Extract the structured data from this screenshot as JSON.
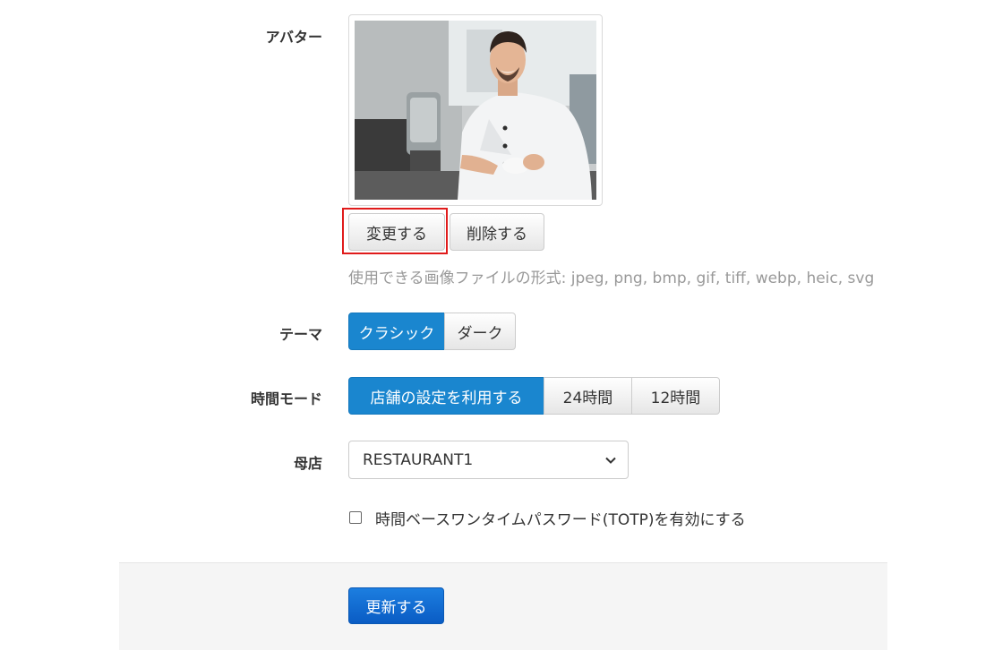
{
  "avatar": {
    "label": "アバター",
    "change_button": "変更する",
    "delete_button": "削除する",
    "formats_hint": "使用できる画像ファイルの形式: jpeg, png, bmp, gif, tiff, webp, heic, svg"
  },
  "theme": {
    "label": "テーマ",
    "options": [
      "クラシック",
      "ダーク"
    ],
    "selected": "クラシック"
  },
  "time_mode": {
    "label": "時間モード",
    "options": [
      "店舗の設定を利用する",
      "24時間",
      "12時間"
    ],
    "selected": "店舗の設定を利用する"
  },
  "parent_store": {
    "label": "母店",
    "selected_value": "RESTAURANT1"
  },
  "totp": {
    "label": "時間ベースワンタイムパスワード(TOTP)を有効にする",
    "checked": false
  },
  "footer": {
    "submit_button": "更新する"
  },
  "colors": {
    "active_segment": "#1a86cf",
    "primary_button": "#0a5cc4",
    "highlight": "#e01b1b"
  }
}
